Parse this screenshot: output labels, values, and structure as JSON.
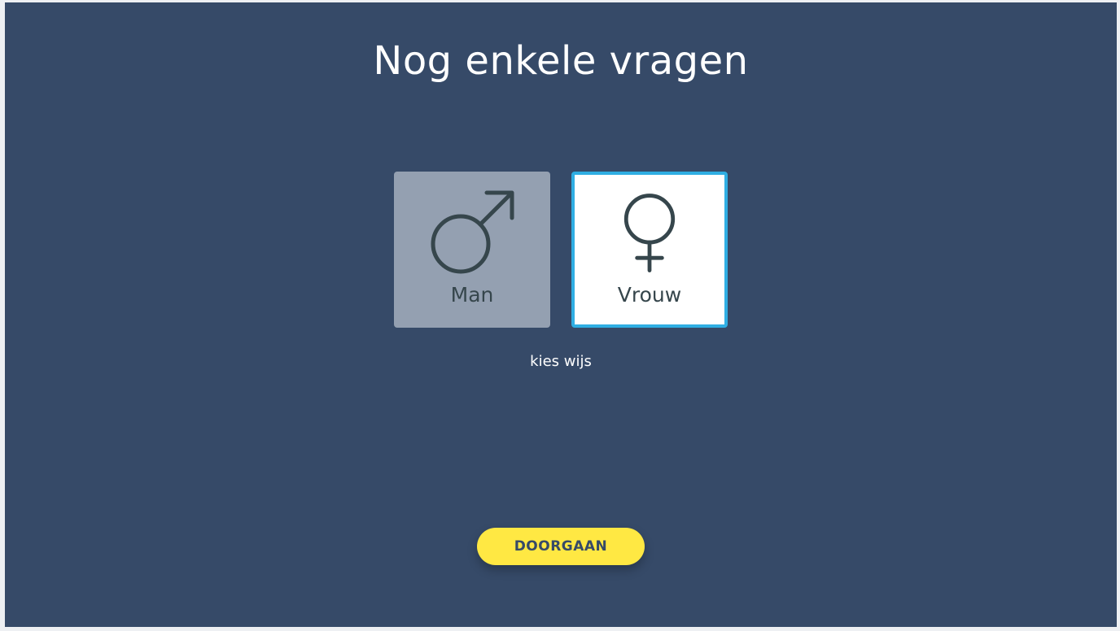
{
  "page": {
    "title": "Nog enkele vragen",
    "hint": "kies wijs"
  },
  "options": [
    {
      "label": "Man",
      "icon": "male-symbol-icon",
      "selected": false
    },
    {
      "label": "Vrouw",
      "icon": "female-symbol-icon",
      "selected": true
    }
  ],
  "actions": {
    "continue_label": "DOORGAAN"
  },
  "colors": {
    "background": "#364a68",
    "selected_border": "#2faee3",
    "unselected_tile": "#94a0b1",
    "button": "#ffe843"
  }
}
